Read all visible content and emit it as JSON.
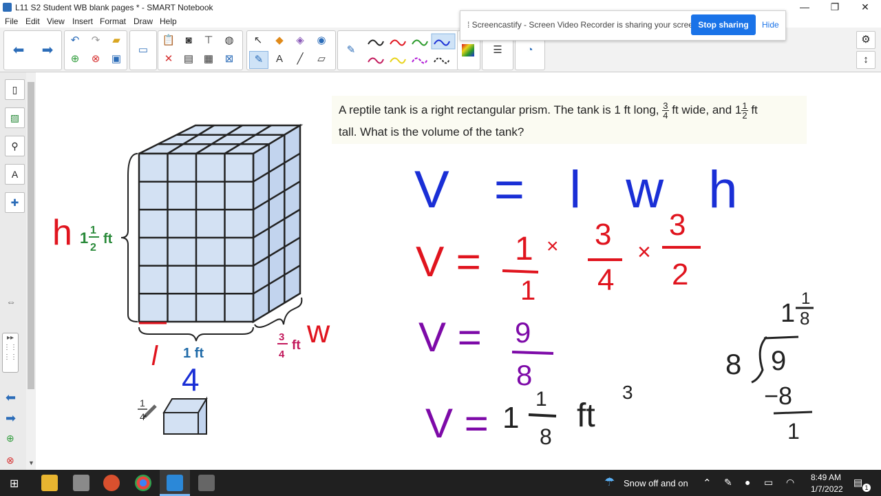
{
  "window": {
    "title": "L11 S2 Student WB blank pages * - SMART Notebook"
  },
  "menu": [
    "File",
    "Edit",
    "View",
    "Insert",
    "Format",
    "Draw",
    "Help"
  ],
  "notification": {
    "message": "Screencastify - Screen Video Recorder is sharing your screen.",
    "stop_label": "Stop sharing",
    "hide_label": "Hide"
  },
  "problem": {
    "line1_a": "A reptile tank is a right rectangular prism. The tank is 1 ft long,",
    "w_num": "3",
    "w_den": "4",
    "line1_b": "ft wide, and 1",
    "h_num": "1",
    "h_den": "2",
    "line1_c": "ft",
    "line2": "tall. What is the volume of the tank?"
  },
  "figure": {
    "height_label_whole": "1",
    "height_label_num": "1",
    "height_label_den": "2",
    "height_label_unit": "ft",
    "length_label": "1 ft",
    "width_label_num": "3",
    "width_label_den": "4",
    "width_label_unit": "ft",
    "unit_cube_num": "1",
    "unit_cube_den": "4"
  },
  "handwriting": {
    "h": "h",
    "l": "l",
    "w": "w",
    "four": "4",
    "eq1": "V = l w h",
    "eq2_lhs": "V =",
    "eq2_f1_num": "1",
    "eq2_f1_den": "1",
    "times1": "×",
    "eq2_f2_num": "3",
    "eq2_f2_den": "4",
    "times2": "×",
    "eq2_f3_num": "3",
    "eq2_f3_den": "2",
    "eq3_lhs": "V =",
    "eq3_num": "9",
    "eq3_den": "8",
    "eq4_lhs": "V =",
    "eq4_whole": "1",
    "eq4_num": "1",
    "eq4_den": "8",
    "eq4_unit": "ft",
    "eq4_exp": "3",
    "div_quotient_whole": "1",
    "div_quotient_num": "1",
    "div_quotient_den": "8",
    "div_divisor": "8",
    "div_dividend": "9",
    "div_sub": "−8",
    "div_rem": "1"
  },
  "taskbar": {
    "weather": "Snow off and on",
    "time": "8:49 AM",
    "date": "1/7/2022",
    "notification_count": "1"
  },
  "colors": {
    "blue_ink": "#1a2fd6",
    "red_ink": "#e0141e",
    "purple_ink": "#7d0aa8",
    "green_label": "#2a8a3a",
    "magenta_label": "#c2185b",
    "cube_fill": "#d3e1f3",
    "accent": "#1a73e8"
  }
}
